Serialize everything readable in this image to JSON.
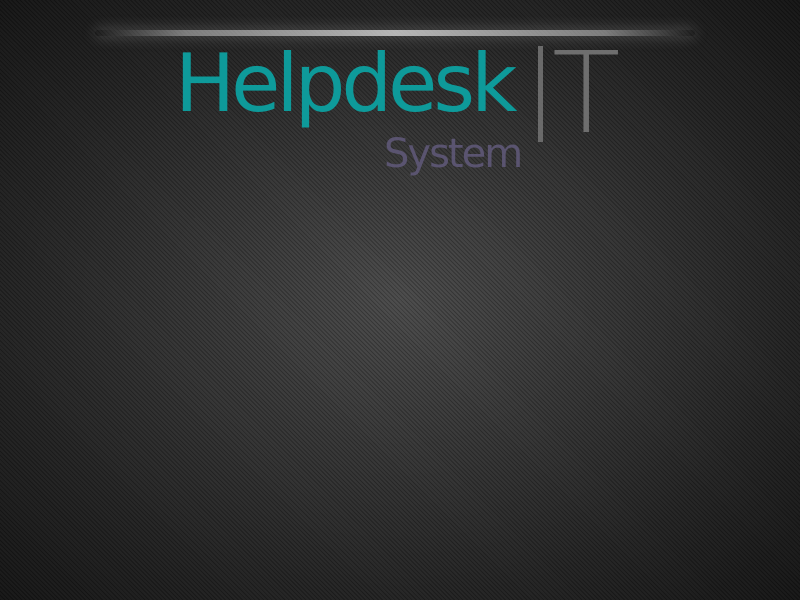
{
  "logo": {
    "main": "Helpdesk",
    "badge": "T",
    "sub": "System"
  },
  "colors": {
    "main": "#0e9a9a",
    "badge": "#6e6e6e",
    "sub": "#5a5470",
    "background": "#2b2b2b"
  }
}
